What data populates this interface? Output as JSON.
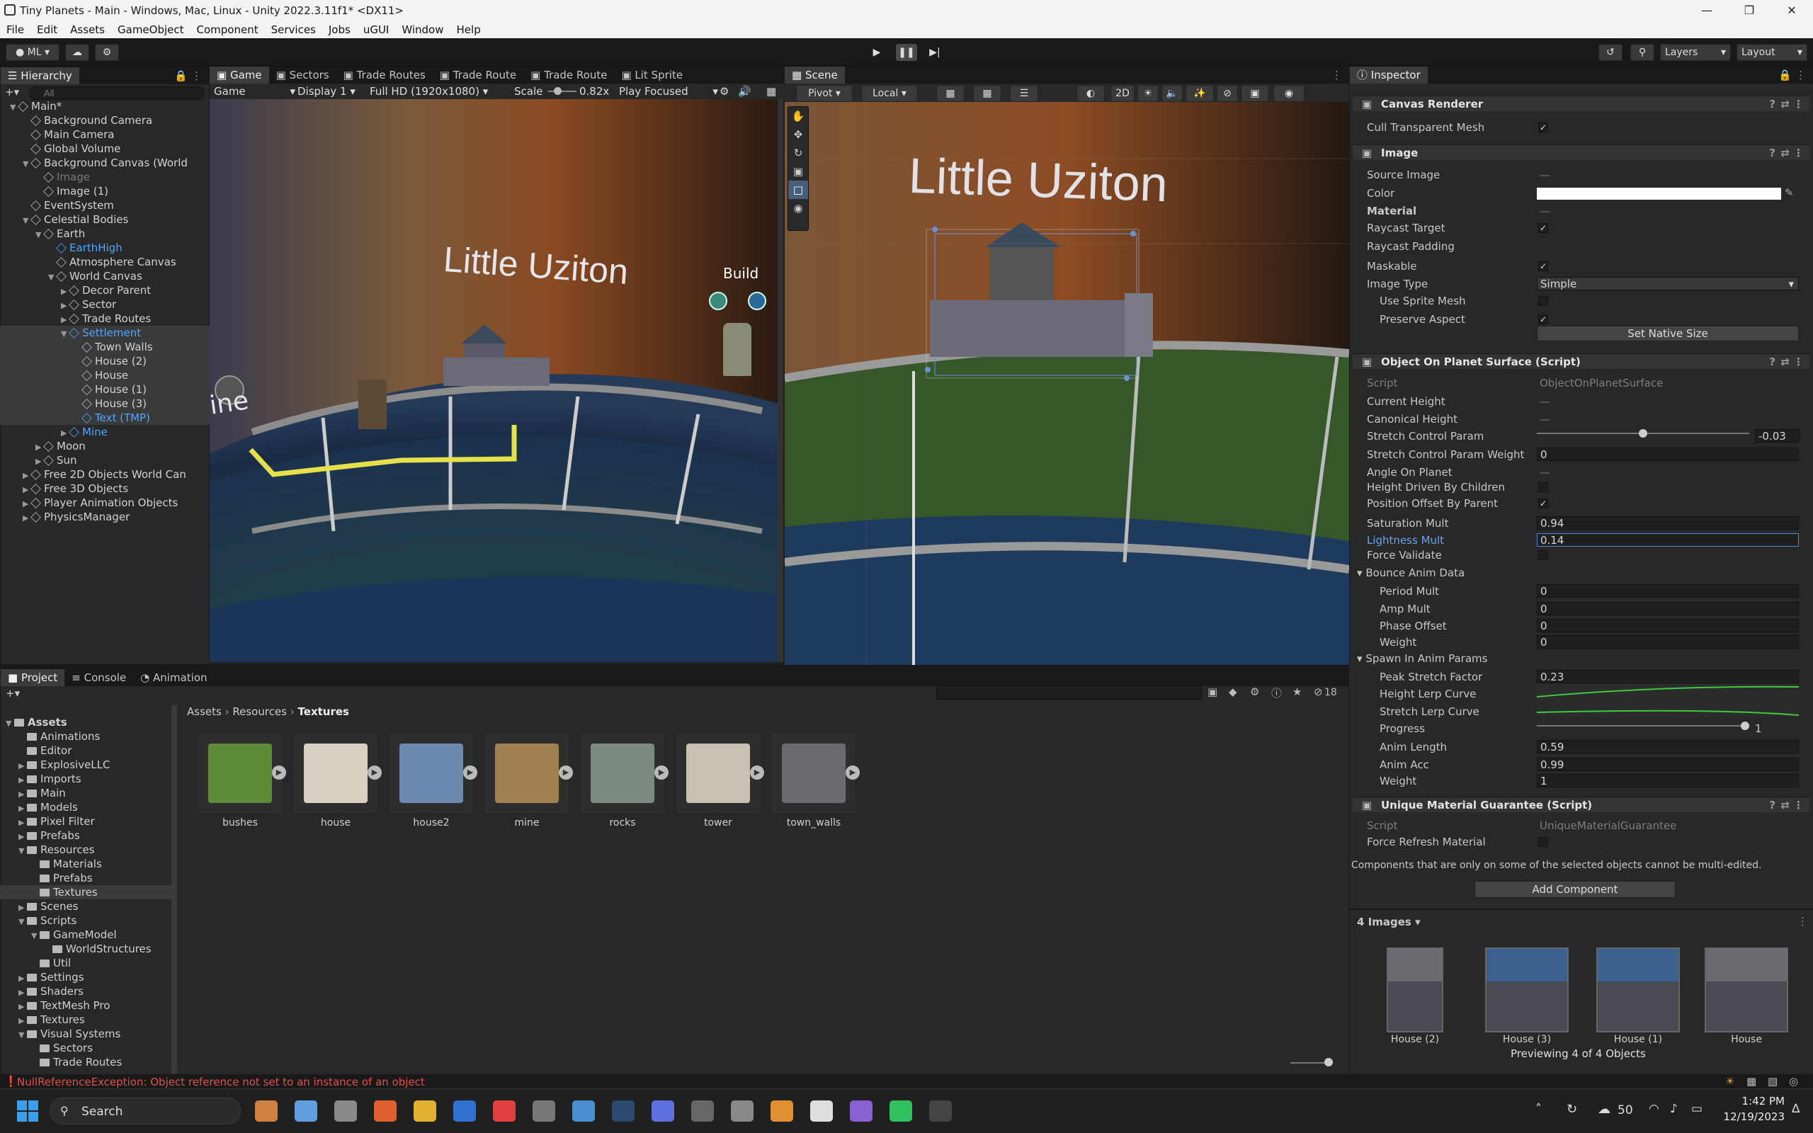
{
  "window": {
    "title": "Tiny Planets - Main - Windows, Mac, Linux - Unity 2022.3.11f1* <DX11>"
  },
  "menu": [
    "File",
    "Edit",
    "Assets",
    "GameObject",
    "Component",
    "Services",
    "Jobs",
    "uGUI",
    "Window",
    "Help"
  ],
  "toolbar": {
    "account": "ML",
    "layers": "Layers",
    "layout": "Layout"
  },
  "hierarchy": {
    "tab": "Hierarchy",
    "search_placeholder": "All",
    "rows": [
      {
        "label": "Main*",
        "indent": 0
      },
      {
        "label": "Background Camera",
        "indent": 1
      },
      {
        "label": "Main Camera",
        "indent": 1
      },
      {
        "label": "Global Volume",
        "indent": 1
      },
      {
        "label": "Background Canvas (World",
        "indent": 1
      },
      {
        "label": "Image",
        "indent": 2
      },
      {
        "label": "Image (1)",
        "indent": 2
      },
      {
        "label": "EventSystem",
        "indent": 1
      },
      {
        "label": "Celestial Bodies",
        "indent": 1
      },
      {
        "label": "Earth",
        "indent": 2
      },
      {
        "label": "EarthHigh",
        "indent": 3
      },
      {
        "label": "Atmosphere Canvas",
        "indent": 3
      },
      {
        "label": "World Canvas",
        "indent": 3
      },
      {
        "label": "Decor Parent",
        "indent": 4
      },
      {
        "label": "Sector",
        "indent": 4
      },
      {
        "label": "Trade Routes",
        "indent": 4
      },
      {
        "label": "Settlement",
        "indent": 4
      },
      {
        "label": "Town Walls",
        "indent": 5
      },
      {
        "label": "House (2)",
        "indent": 5
      },
      {
        "label": "House",
        "indent": 5
      },
      {
        "label": "House (1)",
        "indent": 5
      },
      {
        "label": "House (3)",
        "indent": 5
      },
      {
        "label": "Text (TMP)",
        "indent": 5
      },
      {
        "label": "Mine",
        "indent": 4
      },
      {
        "label": "Moon",
        "indent": 2
      },
      {
        "label": "Sun",
        "indent": 2
      },
      {
        "label": "Free 2D Objects World Can",
        "indent": 1
      },
      {
        "label": "Free 3D Objects",
        "indent": 1
      },
      {
        "label": "Player Animation Objects",
        "indent": 1
      },
      {
        "label": "PhysicsManager",
        "indent": 1
      }
    ]
  },
  "game_view": {
    "tabs": [
      "Game",
      "Sectors",
      "Trade Routes",
      "Trade Route",
      "Trade Route",
      "Lit Sprite"
    ],
    "mode": "Game",
    "display": "Display 1",
    "resolution": "Full HD (1920x1080)",
    "scale_label": "Scale",
    "scale_value": "0.82x",
    "play_focus": "Play Focused",
    "planet_name": "Little Uziton",
    "build_label": "Build",
    "mine_label": "ine"
  },
  "scene_view": {
    "tab": "Scene",
    "pivot": "Pivot",
    "local": "Local",
    "mode_2d": "2D",
    "planet_name": "Little Uziton"
  },
  "inspector": {
    "tab": "Inspector",
    "canvas_renderer": {
      "title": "Canvas Renderer",
      "cull_label": "Cull Transparent Mesh"
    },
    "image": {
      "title": "Image",
      "source_image": "Source Image",
      "color": "Color",
      "material": "Material",
      "raycast_target": "Raycast Target",
      "raycast_padding": "Raycast Padding",
      "maskable": "Maskable",
      "image_type": "Image Type",
      "image_type_value": "Simple",
      "use_sprite_mesh": "Use Sprite Mesh",
      "preserve_aspect": "Preserve Aspect",
      "set_native_size": "Set Native Size",
      "none_value": "—"
    },
    "object_on_planet": {
      "title": "Object On Planet Surface (Script)",
      "script": "Script",
      "script_value": "ObjectOnPlanetSurface",
      "current_height": "Current Height",
      "canonical_height": "Canonical Height",
      "stretch_param": "Stretch Control Param",
      "stretch_param_value": "-0.03",
      "stretch_weight": "Stretch Control Param Weight",
      "stretch_weight_value": "0",
      "angle": "Angle On Planet",
      "height_driven": "Height Driven By Children",
      "position_offset": "Position Offset By Parent",
      "saturation": "Saturation Mult",
      "saturation_value": "0.94",
      "lightness": "Lightness Mult",
      "lightness_value": "0.14",
      "force_validate": "Force Validate",
      "bounce": "Bounce Anim Data",
      "period": "Period Mult",
      "period_value": "0",
      "amp": "Amp Mult",
      "amp_value": "0",
      "phase": "Phase Offset",
      "phase_value": "0",
      "weight": "Weight",
      "weight_value": "0",
      "spawn": "Spawn In Anim Params",
      "peak": "Peak Stretch Factor",
      "peak_value": "0.23",
      "height_curve": "Height Lerp Curve",
      "stretch_curve": "Stretch Lerp Curve",
      "progress": "Progress",
      "progress_value": "1",
      "anim_length": "Anim Length",
      "anim_length_value": "0.59",
      "anim_acc": "Anim Acc",
      "anim_acc_value": "0.99",
      "weight2": "Weight",
      "weight2_value": "1"
    },
    "unique_material": {
      "title": "Unique Material Guarantee (Script)",
      "script": "Script",
      "script_value": "UniqueMaterialGuarantee",
      "force_refresh": "Force Refresh Material"
    },
    "multi_edit_note": "Components that are only on some of the selected objects cannot be multi-edited.",
    "add_component": "Add Component",
    "images_header": "4 Images",
    "previews": [
      "House (2)",
      "House (3)",
      "House (1)",
      "House"
    ],
    "previewing": "Previewing 4 of 4 Objects"
  },
  "project": {
    "tabs": [
      "Project",
      "Console",
      "Animation"
    ],
    "breadcrumb": [
      "Assets",
      "Resources",
      "Textures"
    ],
    "hidden_count": "18",
    "tree": [
      {
        "label": "Assets",
        "indent": 0
      },
      {
        "label": "Animations",
        "indent": 1
      },
      {
        "label": "Editor",
        "indent": 1
      },
      {
        "label": "ExplosiveLLC",
        "indent": 1
      },
      {
        "label": "Imports",
        "indent": 1
      },
      {
        "label": "Main",
        "indent": 1
      },
      {
        "label": "Models",
        "indent": 1
      },
      {
        "label": "Pixel Filter",
        "indent": 1
      },
      {
        "label": "Prefabs",
        "indent": 1
      },
      {
        "label": "Resources",
        "indent": 1
      },
      {
        "label": "Materials",
        "indent": 2
      },
      {
        "label": "Prefabs",
        "indent": 2
      },
      {
        "label": "Textures",
        "indent": 2
      },
      {
        "label": "Scenes",
        "indent": 1
      },
      {
        "label": "Scripts",
        "indent": 1
      },
      {
        "label": "GameModel",
        "indent": 2
      },
      {
        "label": "WorldStructures",
        "indent": 3
      },
      {
        "label": "Util",
        "indent": 2
      },
      {
        "label": "Settings",
        "indent": 1
      },
      {
        "label": "Shaders",
        "indent": 1
      },
      {
        "label": "TextMesh Pro",
        "indent": 1
      },
      {
        "label": "Textures",
        "indent": 1
      },
      {
        "label": "Visual Systems",
        "indent": 1
      },
      {
        "label": "Sectors",
        "indent": 2
      },
      {
        "label": "Trade Routes",
        "indent": 2
      }
    ],
    "assets": [
      "bushes",
      "house",
      "house2",
      "mine",
      "rocks",
      "tower",
      "town_walls"
    ]
  },
  "status": {
    "error": "NullReferenceException: Object reference not set to an instance of an object"
  },
  "taskbar": {
    "search": "Search",
    "temp": "50",
    "time": "1:42 PM",
    "date": "12/19/2023"
  }
}
